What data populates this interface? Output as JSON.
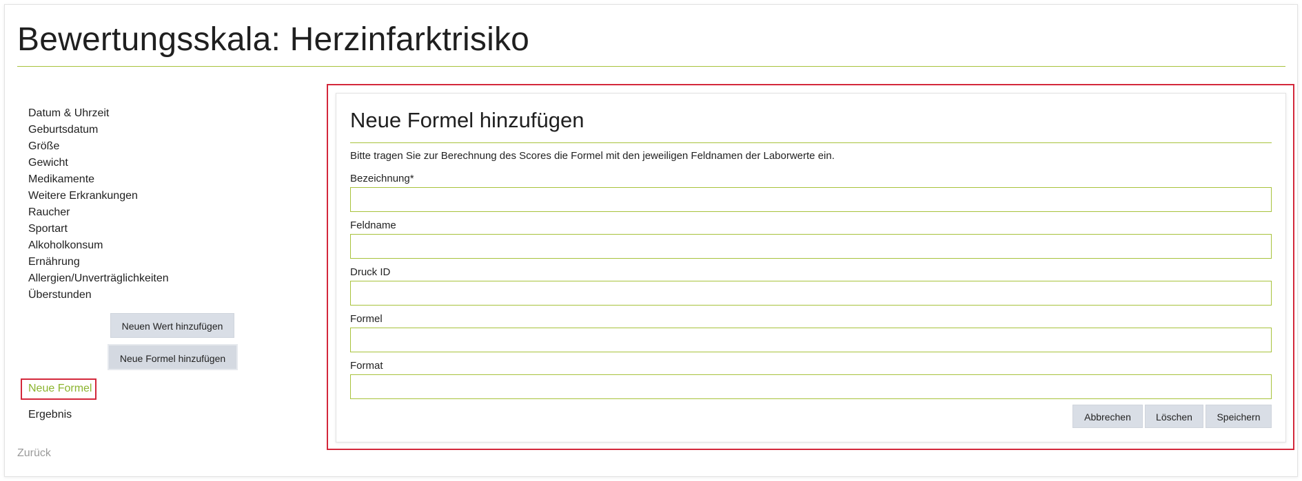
{
  "page": {
    "title": "Bewertungsskala: Herzinfarktrisiko"
  },
  "sidebar": {
    "items": [
      {
        "label": "Datum & Uhrzeit"
      },
      {
        "label": "Geburtsdatum"
      },
      {
        "label": "Größe"
      },
      {
        "label": "Gewicht"
      },
      {
        "label": "Medikamente"
      },
      {
        "label": "Weitere Erkrankungen"
      },
      {
        "label": "Raucher"
      },
      {
        "label": "Sportart"
      },
      {
        "label": "Alkoholkonsum"
      },
      {
        "label": "Ernährung"
      },
      {
        "label": "Allergien/Unverträglichkeiten"
      },
      {
        "label": "Überstunden"
      }
    ],
    "add_value_button": "Neuen Wert hinzufügen",
    "add_formula_button": "Neue Formel hinzufügen",
    "selected_formula": "Neue Formel",
    "result_link": "Ergebnis",
    "back_link": "Zurück"
  },
  "form": {
    "title": "Neue Formel hinzufügen",
    "description": "Bitte tragen Sie zur Berechnung des Scores die Formel mit den jeweiligen Feldnamen der Laborwerte ein.",
    "fields": [
      {
        "label": "Bezeichnung*",
        "value": ""
      },
      {
        "label": "Feldname",
        "value": ""
      },
      {
        "label": "Druck ID",
        "value": ""
      },
      {
        "label": "Formel",
        "value": ""
      },
      {
        "label": "Format",
        "value": ""
      }
    ],
    "buttons": {
      "cancel": "Abbrechen",
      "delete": "Löschen",
      "save": "Speichern"
    }
  },
  "colors": {
    "accent_green": "#a7c23a",
    "active_link_green": "#8bb42e",
    "highlight_red": "#d3273a",
    "button_bg": "#d9dee6"
  }
}
